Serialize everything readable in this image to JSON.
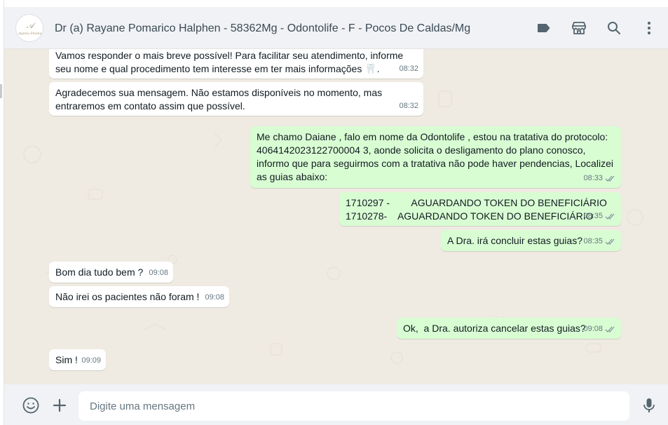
{
  "header": {
    "title": "Dr (a) Rayane Pomarico Halphen - 58362Mg - Odontolife - F - Pocos De Caldas/Mg",
    "avatar_text": "Ayana Stuma"
  },
  "messages": [
    {
      "dir": "in",
      "text": "Vamos responder o mais breve possível! Para facilitar seu atendimento, informe\nseu nome e qual procedimento tem interesse em ter mais informações 🦷.",
      "time": "08:32"
    },
    {
      "dir": "in",
      "text": "Agradecemos sua mensagem. Não estamos disponíveis no momento, mas\nentraremos em contato assim que possível.",
      "time": "08:32"
    },
    {
      "dir": "out",
      "text": "Me chamo Daiane , falo em nome da Odontolife , estou na tratativa do protocolo:\n4064142023122700004 3, aonde solicita o desligamento do plano conosco,\ninformo que para seguirmos com a tratativa não pode haver pendencias, Localizei\nas guias abaixo:",
      "time": "08:33"
    },
    {
      "dir": "out",
      "text": "1710297 -        AGUARDANDO TOKEN DO BENEFICIÁRIO\n1710278-    AGUARDANDO TOKEN DO BENEFICIÁRIO",
      "time": "08:35"
    },
    {
      "dir": "out",
      "text": "A Dra. irá concluir estas guias?",
      "time": "08:35"
    },
    {
      "dir": "in",
      "text": "Bom dia tudo bem ?",
      "time": "09:08"
    },
    {
      "dir": "in",
      "text": "Não irei os pacientes não foram !",
      "time": "09:08"
    },
    {
      "dir": "out",
      "text": "Ok,  a Dra. autoriza cancelar estas guias?",
      "time": "09:08"
    },
    {
      "dir": "in",
      "text": "Sim !",
      "time": "09:09"
    }
  ],
  "composer": {
    "placeholder": "Digite uma mensagem"
  },
  "icons": {
    "header": [
      "label-icon",
      "store-icon",
      "search-icon",
      "menu-icon"
    ],
    "footer": [
      "emoji-icon",
      "attach-icon",
      "mic-icon"
    ]
  },
  "colors": {
    "incoming": "#ffffff",
    "outgoing": "#d9fdd3",
    "chat_bg": "#efeae2",
    "bar_bg": "#f0f2f5"
  }
}
